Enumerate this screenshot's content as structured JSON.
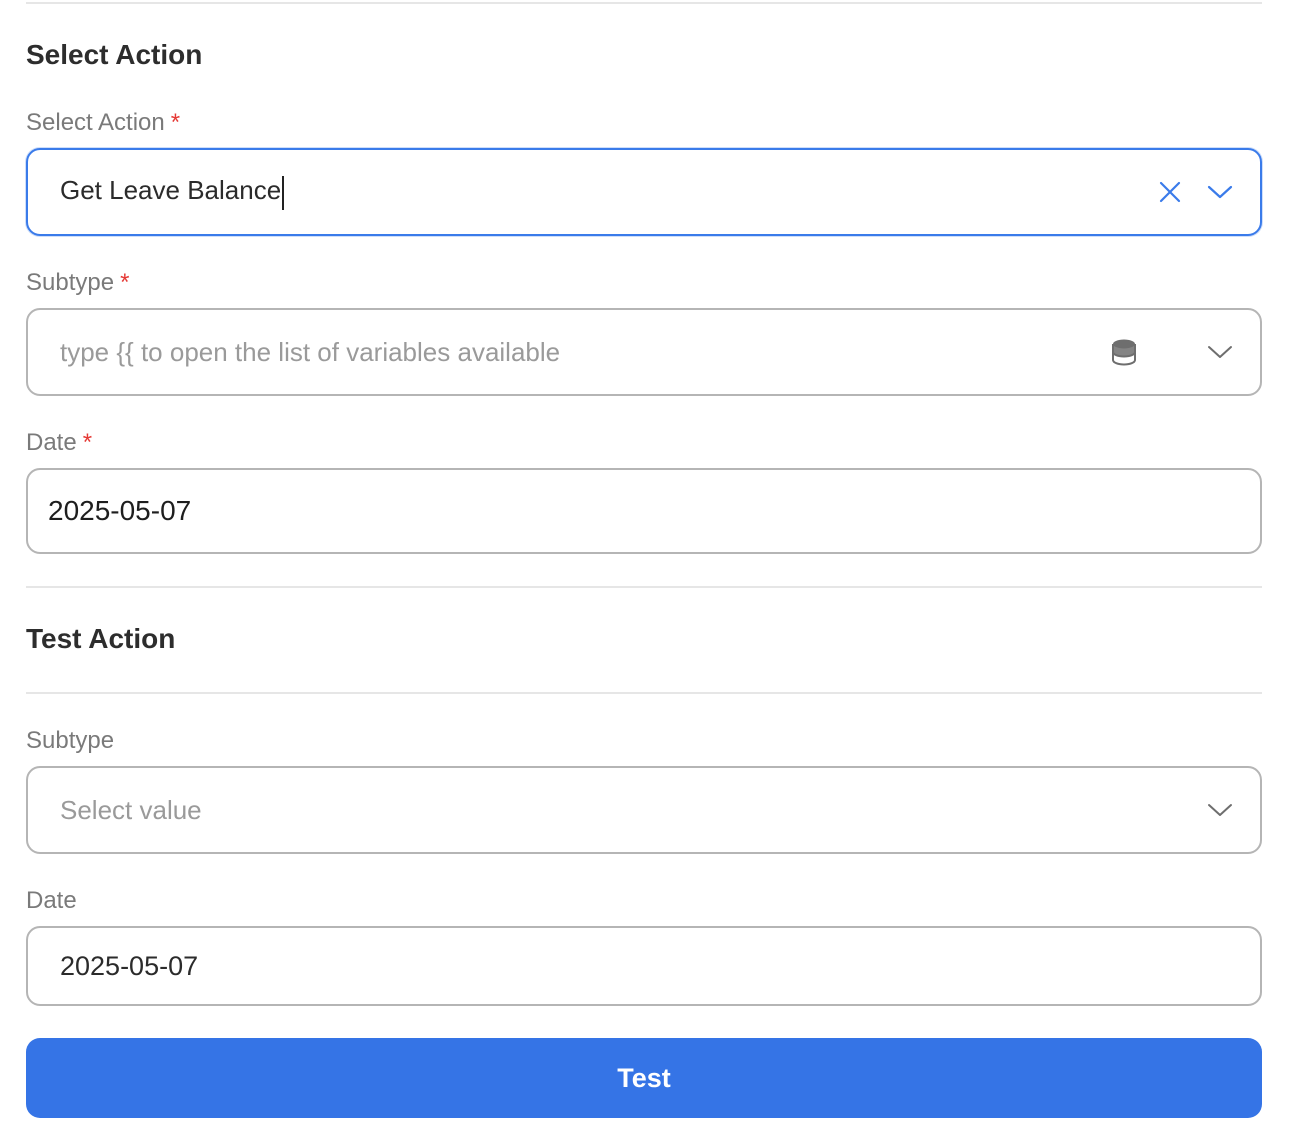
{
  "select_section": {
    "title": "Select Action",
    "action_field": {
      "label": "Select Action",
      "required_marker": "*",
      "value": "Get Leave Balance"
    },
    "subtype_field": {
      "label": "Subtype",
      "required_marker": "*",
      "placeholder": "type {{ to open the list of variables available"
    },
    "date_field": {
      "label": "Date",
      "required_marker": "*",
      "value": "2025-05-07"
    }
  },
  "test_section": {
    "title": "Test Action",
    "subtype_field": {
      "label": "Subtype",
      "placeholder": "Select value"
    },
    "date_field": {
      "label": "Date",
      "value": "2025-05-07"
    },
    "test_button_label": "Test"
  },
  "icons": {
    "clear": "close-icon",
    "dropdown": "chevron-down-icon",
    "variables": "database-icon"
  },
  "colors": {
    "accent": "#3574e6",
    "focus_border": "#3a7bea",
    "required": "#e53935"
  }
}
